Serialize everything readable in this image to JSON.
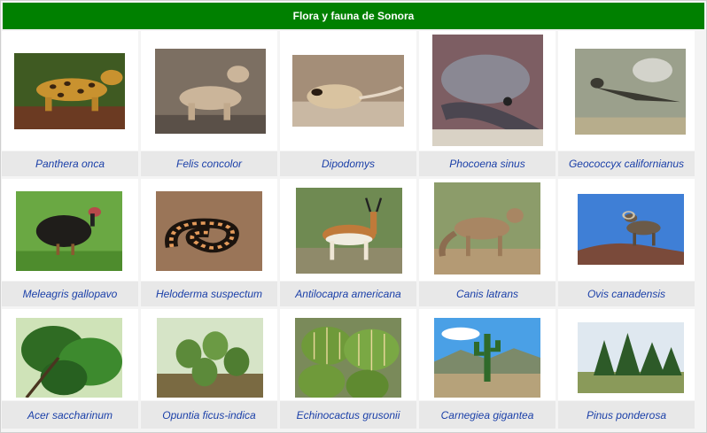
{
  "title": "Flora y fauna de Sonora",
  "species": [
    {
      "name": "Panthera onca",
      "photo": "jaguar-photo"
    },
    {
      "name": "Felis concolor",
      "photo": "puma-photo"
    },
    {
      "name": "Dipodomys",
      "photo": "kangaroo-rat-photo"
    },
    {
      "name": "Phocoena sinus",
      "photo": "vaquita-photo"
    },
    {
      "name": "Geococcyx californianus",
      "photo": "roadrunner-photo"
    },
    {
      "name": "Meleagris gallopavo",
      "photo": "turkey-photo"
    },
    {
      "name": "Heloderma suspectum",
      "photo": "gila-monster-photo"
    },
    {
      "name": "Antilocapra americana",
      "photo": "pronghorn-photo"
    },
    {
      "name": "Canis latrans",
      "photo": "coyote-photo"
    },
    {
      "name": "Ovis canadensis",
      "photo": "bighorn-sheep-photo"
    },
    {
      "name": "Acer saccharinum",
      "photo": "maple-photo"
    },
    {
      "name": "Opuntia ficus-indica",
      "photo": "prickly-pear-photo"
    },
    {
      "name": "Echinocactus grusonii",
      "photo": "barrel-cactus-photo"
    },
    {
      "name": "Carnegiea gigantea",
      "photo": "saguaro-photo"
    },
    {
      "name": "Pinus ponderosa",
      "photo": "pine-photo"
    }
  ]
}
